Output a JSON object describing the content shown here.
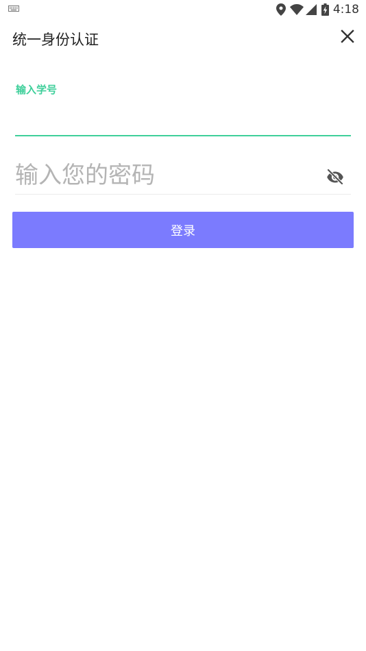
{
  "status_bar": {
    "time": "4:18",
    "icons": [
      "keyboard-icon",
      "location-icon",
      "wifi-icon",
      "signal-icon",
      "battery-charging-icon"
    ]
  },
  "header": {
    "title": "统一身份认证",
    "close_icon": "close-icon"
  },
  "form": {
    "student_id": {
      "label": "输入学号",
      "value": ""
    },
    "password": {
      "placeholder": "输入您的密码",
      "value": "",
      "toggle_icon": "eye-off-icon"
    },
    "login_label": "登录"
  },
  "colors": {
    "accent_green": "#3ecf9a",
    "button_purple": "#7b7bfe",
    "placeholder_gray": "#b4b4b4",
    "text_dark": "#222222"
  }
}
